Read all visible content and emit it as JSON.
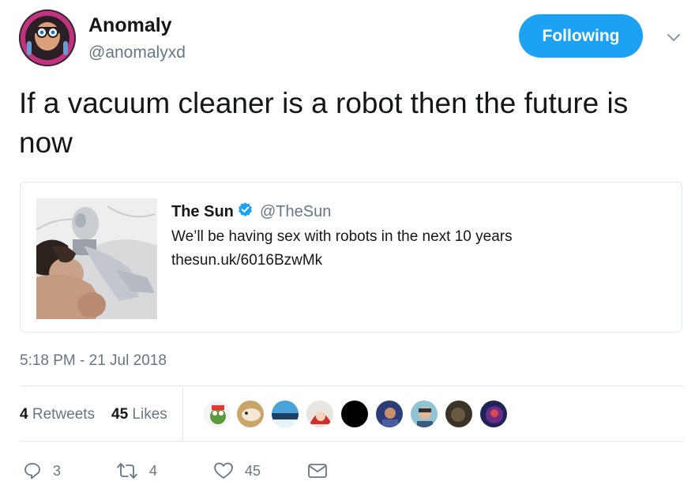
{
  "author": {
    "name": "Anomaly",
    "handle": "@anomalyxd",
    "follow_label": "Following"
  },
  "tweet": {
    "text": "If a vacuum cleaner is a robot then the future is now",
    "timestamp": "5:18 PM - 21 Jul 2018"
  },
  "quoted_tweet": {
    "name": "The Sun",
    "handle": "@TheSun",
    "text": "We’ll be having sex with robots in the next 10 years",
    "link": "thesun.uk/6016BzwMk"
  },
  "stats": {
    "retweets_count": "4",
    "retweets_label": "Retweets",
    "likes_count": "45",
    "likes_label": "Likes"
  },
  "actions": {
    "reply_count": "3",
    "retweet_count": "4",
    "like_count": "45"
  },
  "colors": {
    "accent": "#1da1f2",
    "muted": "#657786",
    "text": "#14171a",
    "border": "#e1e8ed"
  }
}
